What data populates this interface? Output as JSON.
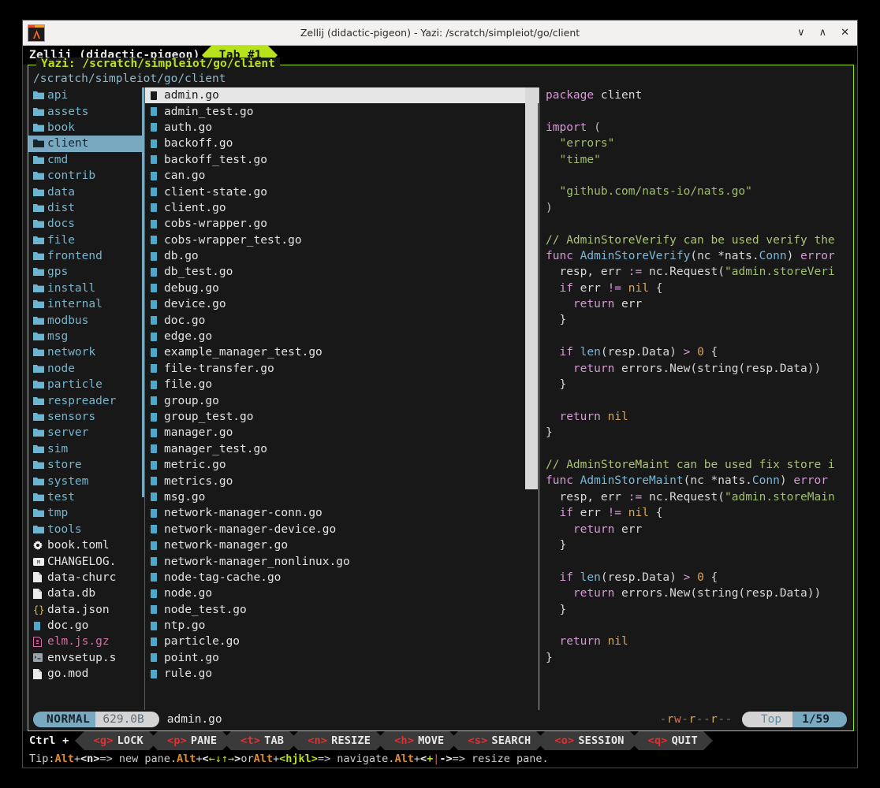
{
  "window": {
    "title": "Zellij (didactic-pigeon) - Yazi: /scratch/simpleiot/go/client",
    "icon": "alacritty-icon",
    "minimize": "∨",
    "maximize": "∧",
    "close": "✕"
  },
  "zellij": {
    "session": "Zellij (didactic-pigeon)",
    "tab": "Tab #1",
    "ctrl_label": "Ctrl +",
    "keys": [
      {
        "key": "<g>",
        "label": "LOCK"
      },
      {
        "key": "<p>",
        "label": "PANE"
      },
      {
        "key": "<t>",
        "label": "TAB"
      },
      {
        "key": "<n>",
        "label": "RESIZE"
      },
      {
        "key": "<h>",
        "label": "MOVE"
      },
      {
        "key": "<s>",
        "label": "SEARCH"
      },
      {
        "key": "<o>",
        "label": "SESSION"
      },
      {
        "key": "<q>",
        "label": "QUIT"
      }
    ],
    "tip": {
      "prefix": "Tip: ",
      "alt1": "Alt",
      "plus1": " + ",
      "key1": "<n>",
      "mid1": " => new pane. ",
      "alt2": "Alt",
      "plus2": " + ",
      "arrows_open": "<",
      "arrows": "←↓↑→",
      "arrows_close": ">",
      "mid2": " or ",
      "alt3": "Alt",
      "plus3": " + ",
      "key3": "<hjkl>",
      "mid3": " => navigate. ",
      "alt4": "Alt",
      "plus4": " + ",
      "resize_open": "<",
      "resize_plus": "+",
      "resize_bar": "|",
      "resize_minus": "-",
      "resize_close": ">",
      "suffix": " => resize pane."
    }
  },
  "pane": {
    "title": "Yazi: /scratch/simpleiot/go/client",
    "cwd": "/scratch/simpleiot/go/client"
  },
  "parent_column": {
    "items": [
      {
        "name": "api",
        "type": "dir",
        "icon": "folder-icon",
        "selected": false
      },
      {
        "name": "assets",
        "type": "dir",
        "icon": "folder-icon",
        "selected": false
      },
      {
        "name": "book",
        "type": "dir",
        "icon": "folder-icon",
        "selected": false
      },
      {
        "name": "client",
        "type": "dir",
        "icon": "folder-icon",
        "selected": true
      },
      {
        "name": "cmd",
        "type": "dir",
        "icon": "folder-icon",
        "selected": false
      },
      {
        "name": "contrib",
        "type": "dir",
        "icon": "folder-icon",
        "selected": false
      },
      {
        "name": "data",
        "type": "dir",
        "icon": "folder-icon",
        "selected": false
      },
      {
        "name": "dist",
        "type": "dir",
        "icon": "folder-icon",
        "selected": false
      },
      {
        "name": "docs",
        "type": "dir",
        "icon": "folder-icon",
        "selected": false
      },
      {
        "name": "file",
        "type": "dir",
        "icon": "folder-icon",
        "selected": false
      },
      {
        "name": "frontend",
        "type": "dir",
        "icon": "folder-icon",
        "selected": false
      },
      {
        "name": "gps",
        "type": "dir",
        "icon": "folder-icon",
        "selected": false
      },
      {
        "name": "install",
        "type": "dir",
        "icon": "folder-icon",
        "selected": false
      },
      {
        "name": "internal",
        "type": "dir",
        "icon": "folder-icon",
        "selected": false
      },
      {
        "name": "modbus",
        "type": "dir",
        "icon": "folder-icon",
        "selected": false
      },
      {
        "name": "msg",
        "type": "dir",
        "icon": "folder-icon",
        "selected": false
      },
      {
        "name": "network",
        "type": "dir",
        "icon": "folder-icon",
        "selected": false
      },
      {
        "name": "node",
        "type": "dir",
        "icon": "folder-icon",
        "selected": false
      },
      {
        "name": "particle",
        "type": "dir",
        "icon": "folder-icon",
        "selected": false
      },
      {
        "name": "respreader",
        "type": "dir",
        "icon": "folder-icon",
        "selected": false
      },
      {
        "name": "sensors",
        "type": "dir",
        "icon": "folder-icon",
        "selected": false
      },
      {
        "name": "server",
        "type": "dir",
        "icon": "folder-icon",
        "selected": false
      },
      {
        "name": "sim",
        "type": "dir",
        "icon": "folder-icon",
        "selected": false
      },
      {
        "name": "store",
        "type": "dir",
        "icon": "folder-icon",
        "selected": false
      },
      {
        "name": "system",
        "type": "dir",
        "icon": "folder-icon",
        "selected": false
      },
      {
        "name": "test",
        "type": "dir",
        "icon": "folder-icon",
        "selected": false
      },
      {
        "name": "tmp",
        "type": "dir",
        "icon": "folder-icon",
        "selected": false
      },
      {
        "name": "tools",
        "type": "dir",
        "icon": "folder-icon",
        "selected": false
      },
      {
        "name": "book.toml",
        "type": "toml",
        "icon": "gear-icon",
        "selected": false
      },
      {
        "name": "CHANGELOG.",
        "type": "md",
        "icon": "markdown-icon",
        "selected": false
      },
      {
        "name": "data-churc",
        "type": "file",
        "icon": "page-icon",
        "selected": false
      },
      {
        "name": "data.db",
        "type": "file",
        "icon": "page-icon",
        "selected": false
      },
      {
        "name": "data.json",
        "type": "json",
        "icon": "braces-icon",
        "selected": false
      },
      {
        "name": "doc.go",
        "type": "go",
        "icon": "go-icon",
        "selected": false
      },
      {
        "name": "elm.js.gz",
        "type": "gz",
        "icon": "archive-icon",
        "selected": false
      },
      {
        "name": "envsetup.s",
        "type": "sh",
        "icon": "terminal-icon",
        "selected": false
      },
      {
        "name": "go.mod",
        "type": "file",
        "icon": "page-icon",
        "selected": false
      }
    ]
  },
  "current_column": {
    "items": [
      {
        "name": "admin.go",
        "icon": "go-icon",
        "selected": true
      },
      {
        "name": "admin_test.go",
        "icon": "go-icon",
        "selected": false
      },
      {
        "name": "auth.go",
        "icon": "go-icon",
        "selected": false
      },
      {
        "name": "backoff.go",
        "icon": "go-icon",
        "selected": false
      },
      {
        "name": "backoff_test.go",
        "icon": "go-icon",
        "selected": false
      },
      {
        "name": "can.go",
        "icon": "go-icon",
        "selected": false
      },
      {
        "name": "client-state.go",
        "icon": "go-icon",
        "selected": false
      },
      {
        "name": "client.go",
        "icon": "go-icon",
        "selected": false
      },
      {
        "name": "cobs-wrapper.go",
        "icon": "go-icon",
        "selected": false
      },
      {
        "name": "cobs-wrapper_test.go",
        "icon": "go-icon",
        "selected": false
      },
      {
        "name": "db.go",
        "icon": "go-icon",
        "selected": false
      },
      {
        "name": "db_test.go",
        "icon": "go-icon",
        "selected": false
      },
      {
        "name": "debug.go",
        "icon": "go-icon",
        "selected": false
      },
      {
        "name": "device.go",
        "icon": "go-icon",
        "selected": false
      },
      {
        "name": "doc.go",
        "icon": "go-icon",
        "selected": false
      },
      {
        "name": "edge.go",
        "icon": "go-icon",
        "selected": false
      },
      {
        "name": "example_manager_test.go",
        "icon": "go-icon",
        "selected": false
      },
      {
        "name": "file-transfer.go",
        "icon": "go-icon",
        "selected": false
      },
      {
        "name": "file.go",
        "icon": "go-icon",
        "selected": false
      },
      {
        "name": "group.go",
        "icon": "go-icon",
        "selected": false
      },
      {
        "name": "group_test.go",
        "icon": "go-icon",
        "selected": false
      },
      {
        "name": "manager.go",
        "icon": "go-icon",
        "selected": false
      },
      {
        "name": "manager_test.go",
        "icon": "go-icon",
        "selected": false
      },
      {
        "name": "metric.go",
        "icon": "go-icon",
        "selected": false
      },
      {
        "name": "metrics.go",
        "icon": "go-icon",
        "selected": false
      },
      {
        "name": "msg.go",
        "icon": "go-icon",
        "selected": false
      },
      {
        "name": "network-manager-conn.go",
        "icon": "go-icon",
        "selected": false
      },
      {
        "name": "network-manager-device.go",
        "icon": "go-icon",
        "selected": false
      },
      {
        "name": "network-manager.go",
        "icon": "go-icon",
        "selected": false
      },
      {
        "name": "network-manager_nonlinux.go",
        "icon": "go-icon",
        "selected": false
      },
      {
        "name": "node-tag-cache.go",
        "icon": "go-icon",
        "selected": false
      },
      {
        "name": "node.go",
        "icon": "go-icon",
        "selected": false
      },
      {
        "name": "node_test.go",
        "icon": "go-icon",
        "selected": false
      },
      {
        "name": "ntp.go",
        "icon": "go-icon",
        "selected": false
      },
      {
        "name": "particle.go",
        "icon": "go-icon",
        "selected": false
      },
      {
        "name": "point.go",
        "icon": "go-icon",
        "selected": false
      },
      {
        "name": "rule.go",
        "icon": "go-icon",
        "selected": false
      }
    ]
  },
  "preview": {
    "language": "go",
    "lines": [
      [
        {
          "t": "package",
          "c": "k"
        },
        {
          "t": " client",
          "c": "pl"
        }
      ],
      [],
      [
        {
          "t": "import",
          "c": "k"
        },
        {
          "t": " (",
          "c": "op"
        }
      ],
      [
        {
          "t": "  \"errors\"",
          "c": "s"
        }
      ],
      [
        {
          "t": "  \"time\"",
          "c": "s"
        }
      ],
      [],
      [
        {
          "t": "  \"github.com/nats-io/nats.go\"",
          "c": "s"
        }
      ],
      [
        {
          "t": ")",
          "c": "op"
        }
      ],
      [],
      [
        {
          "t": "// AdminStoreVerify can be used verify the",
          "c": "cm"
        }
      ],
      [
        {
          "t": "func ",
          "c": "k"
        },
        {
          "t": "AdminStoreVerify",
          "c": "fn"
        },
        {
          "t": "(nc *nats.",
          "c": "pl"
        },
        {
          "t": "Conn",
          "c": "fn"
        },
        {
          "t": ") ",
          "c": "pl"
        },
        {
          "t": "error",
          "c": "k"
        }
      ],
      [
        {
          "t": "  resp, err ",
          "c": "pl"
        },
        {
          "t": ":= ",
          "c": "k"
        },
        {
          "t": "nc.Request(",
          "c": "pl"
        },
        {
          "t": "\"admin.storeVeri",
          "c": "s"
        }
      ],
      [
        {
          "t": "  if ",
          "c": "k"
        },
        {
          "t": "err ",
          "c": "pl"
        },
        {
          "t": "!= ",
          "c": "k"
        },
        {
          "t": "nil",
          "c": "nl"
        },
        {
          "t": " {",
          "c": "pl"
        }
      ],
      [
        {
          "t": "    return ",
          "c": "k"
        },
        {
          "t": "err",
          "c": "pl"
        }
      ],
      [
        {
          "t": "  }",
          "c": "pl"
        }
      ],
      [],
      [
        {
          "t": "  if ",
          "c": "k"
        },
        {
          "t": "len",
          "c": "fn"
        },
        {
          "t": "(resp.Data) ",
          "c": "pl"
        },
        {
          "t": "> ",
          "c": "k"
        },
        {
          "t": "0",
          "c": "nl"
        },
        {
          "t": " {",
          "c": "pl"
        }
      ],
      [
        {
          "t": "    return ",
          "c": "k"
        },
        {
          "t": "errors.New(string(resp.Data))",
          "c": "pl"
        }
      ],
      [
        {
          "t": "  }",
          "c": "pl"
        }
      ],
      [],
      [
        {
          "t": "  return ",
          "c": "k"
        },
        {
          "t": "nil",
          "c": "nl"
        }
      ],
      [
        {
          "t": "}",
          "c": "pl"
        }
      ],
      [],
      [
        {
          "t": "// AdminStoreMaint can be used fix store i",
          "c": "cm"
        }
      ],
      [
        {
          "t": "func ",
          "c": "k"
        },
        {
          "t": "AdminStoreMaint",
          "c": "fn"
        },
        {
          "t": "(nc *nats.",
          "c": "pl"
        },
        {
          "t": "Conn",
          "c": "fn"
        },
        {
          "t": ") ",
          "c": "pl"
        },
        {
          "t": "error",
          "c": "k"
        }
      ],
      [
        {
          "t": "  resp, err ",
          "c": "pl"
        },
        {
          "t": ":= ",
          "c": "k"
        },
        {
          "t": "nc.Request(",
          "c": "pl"
        },
        {
          "t": "\"admin.storeMain",
          "c": "s"
        }
      ],
      [
        {
          "t": "  if ",
          "c": "k"
        },
        {
          "t": "err ",
          "c": "pl"
        },
        {
          "t": "!= ",
          "c": "k"
        },
        {
          "t": "nil",
          "c": "nl"
        },
        {
          "t": " {",
          "c": "pl"
        }
      ],
      [
        {
          "t": "    return ",
          "c": "k"
        },
        {
          "t": "err",
          "c": "pl"
        }
      ],
      [
        {
          "t": "  }",
          "c": "pl"
        }
      ],
      [],
      [
        {
          "t": "  if ",
          "c": "k"
        },
        {
          "t": "len",
          "c": "fn"
        },
        {
          "t": "(resp.Data) ",
          "c": "pl"
        },
        {
          "t": "> ",
          "c": "k"
        },
        {
          "t": "0",
          "c": "nl"
        },
        {
          "t": " {",
          "c": "pl"
        }
      ],
      [
        {
          "t": "    return ",
          "c": "k"
        },
        {
          "t": "errors.New(string(resp.Data))",
          "c": "pl"
        }
      ],
      [
        {
          "t": "  }",
          "c": "pl"
        }
      ],
      [],
      [
        {
          "t": "  return ",
          "c": "k"
        },
        {
          "t": "nil",
          "c": "nl"
        }
      ],
      [
        {
          "t": "}",
          "c": "pl"
        }
      ]
    ]
  },
  "status": {
    "mode": "NORMAL",
    "size": "629.0B",
    "filename": "admin.go",
    "permissions": "-rw-r--r--",
    "scroll_label": "Top",
    "position": "1/59"
  },
  "colors": {
    "accent_green": "#b8e21c",
    "pane_border": "#9ae215",
    "dir_blue": "#77b4cc",
    "select_blue": "#79a9c0",
    "bg": "#181818",
    "key_red": "#e03030",
    "alt_orange": "#e08a28"
  }
}
